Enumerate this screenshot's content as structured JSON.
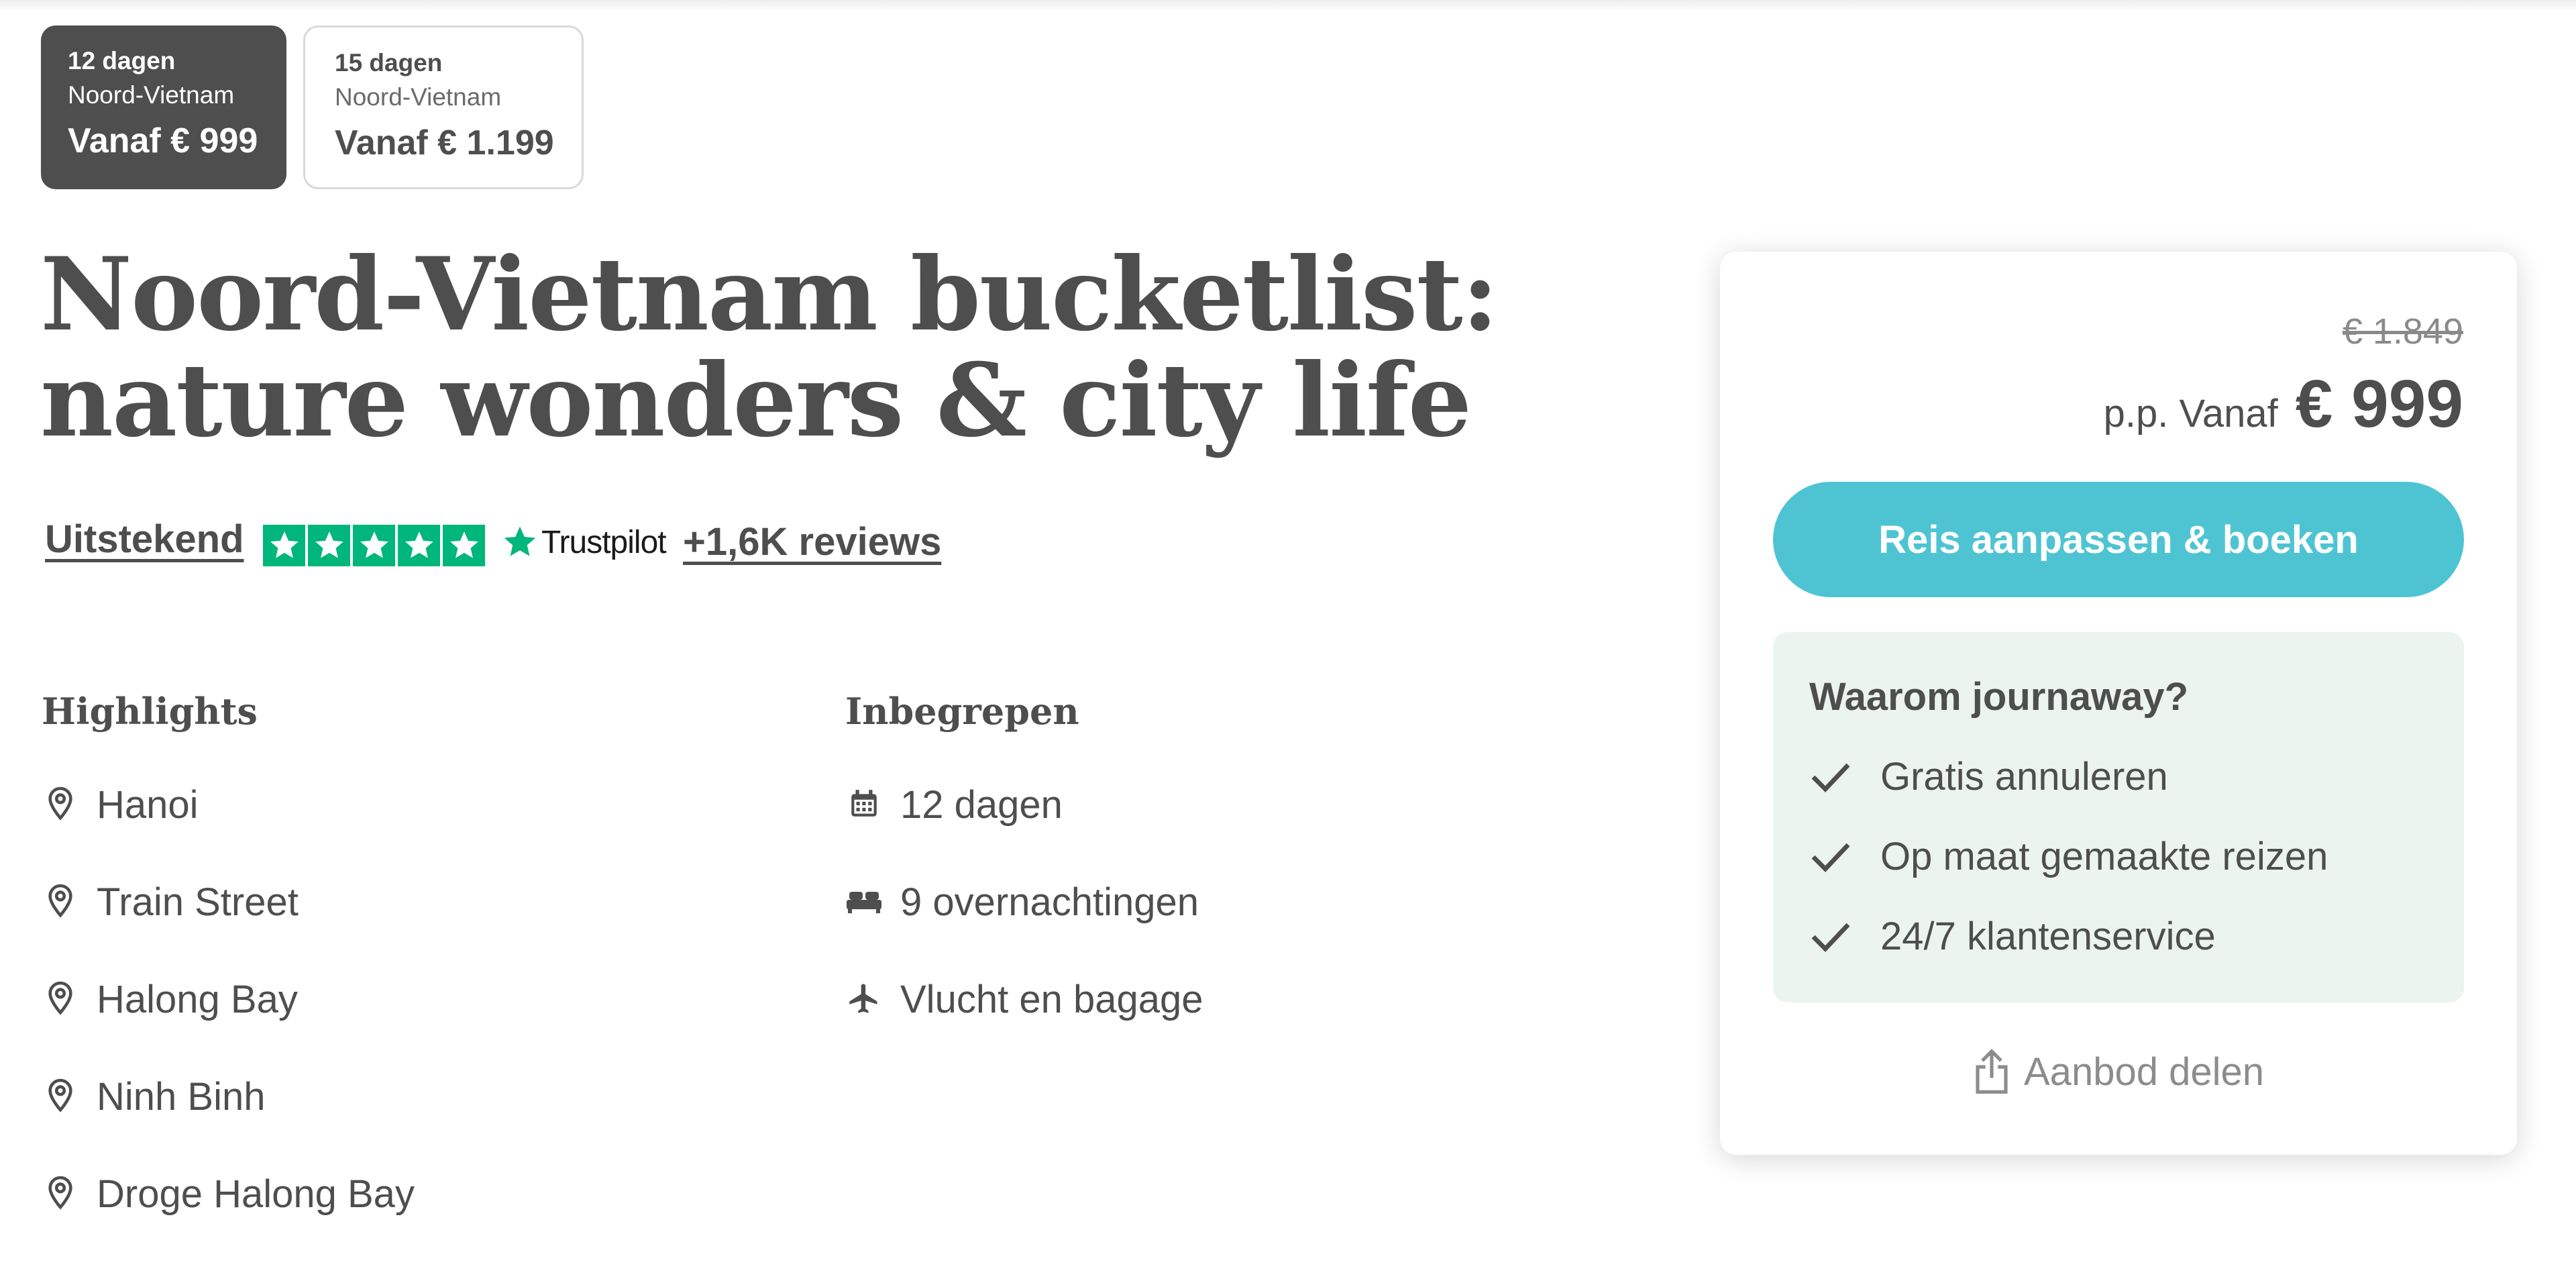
{
  "trip_options": [
    {
      "days": "12 dagen",
      "region": "Noord-Vietnam",
      "price": "Vanaf € 999"
    },
    {
      "days": "15 dagen",
      "region": "Noord-Vietnam",
      "price": "Vanaf € 1.199"
    }
  ],
  "title": "Noord-Vietnam bucketlist: nature wonders & city life",
  "rating": {
    "label": "Uitstekend",
    "stars": 5,
    "provider": "Trustpilot",
    "reviews": "+1,6K reviews",
    "star_color": "#00b67a"
  },
  "highlights": {
    "heading": "Highlights",
    "items": [
      {
        "label": "Hanoi",
        "icon": "map-pin-icon"
      },
      {
        "label": "Train Street",
        "icon": "map-pin-icon"
      },
      {
        "label": "Halong Bay",
        "icon": "map-pin-icon"
      },
      {
        "label": "Ninh Binh",
        "icon": "map-pin-icon"
      },
      {
        "label": "Droge Halong Bay",
        "icon": "map-pin-icon"
      }
    ]
  },
  "included": {
    "heading": "Inbegrepen",
    "items": [
      {
        "label": "12 dagen",
        "icon": "calendar-icon"
      },
      {
        "label": "9 overnachtingen",
        "icon": "bed-icon"
      },
      {
        "label": "Vlucht en bagage",
        "icon": "airplane-icon"
      }
    ]
  },
  "booking": {
    "old_price": "€ 1.849",
    "price_prefix": "p.p. Vanaf",
    "price": "€ 999",
    "button_label": "Reis aanpassen & boeken",
    "button_color": "#4ec4d3",
    "why": {
      "title": "Waarom journaway?",
      "items": [
        "Gratis annuleren",
        "Op maat gemaakte reizen",
        "24/7 klantenservice"
      ]
    },
    "share_label": "Aanbod delen"
  }
}
